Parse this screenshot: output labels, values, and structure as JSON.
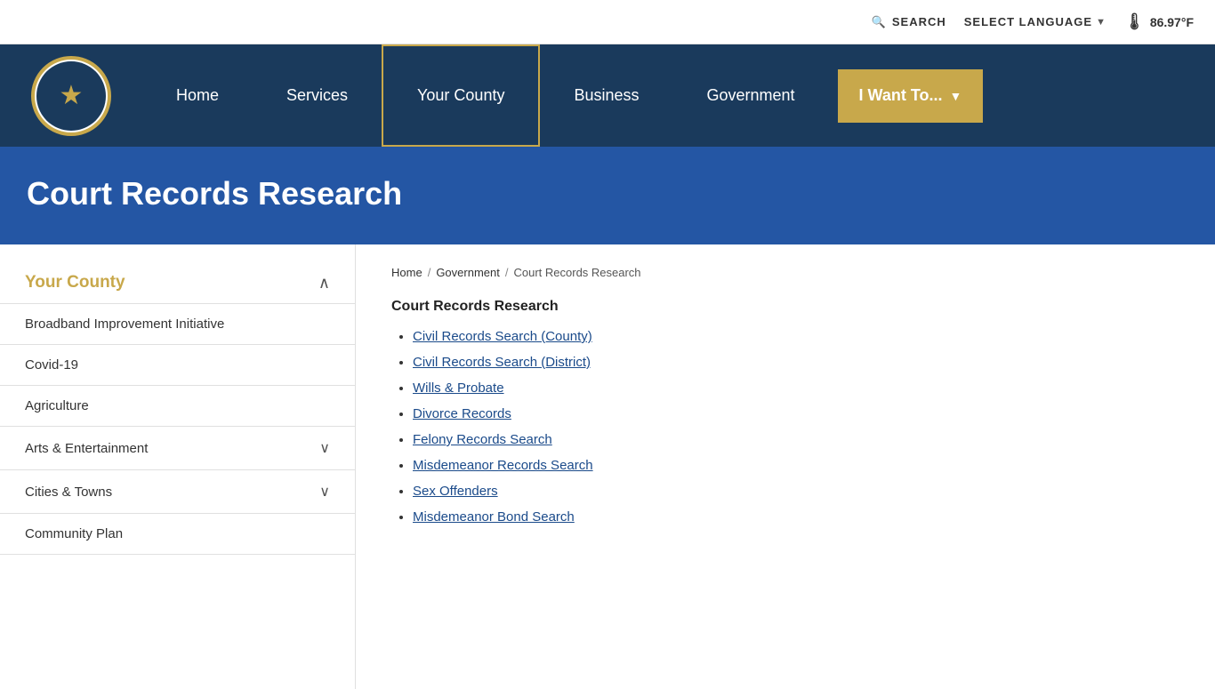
{
  "topbar": {
    "search_label": "SEARCH",
    "language_label": "SELECT LANGUAGE",
    "weather_temp": "86.97°F"
  },
  "header": {
    "logo_alt": "Fort Bend County Seal",
    "nav": {
      "home": "Home",
      "services": "Services",
      "your_county": "Your County",
      "business": "Business",
      "government": "Government",
      "i_want_to": "I Want To..."
    }
  },
  "hero": {
    "title": "Court Records Research"
  },
  "sidebar": {
    "section_title": "Your County",
    "items": [
      {
        "label": "Broadband Improvement Initiative",
        "has_chevron": false
      },
      {
        "label": "Covid-19",
        "has_chevron": false
      },
      {
        "label": "Agriculture",
        "has_chevron": false
      },
      {
        "label": "Arts & Entertainment",
        "has_chevron": true
      },
      {
        "label": "Cities & Towns",
        "has_chevron": true
      },
      {
        "label": "Community Plan",
        "has_chevron": false
      }
    ]
  },
  "breadcrumb": {
    "home": "Home",
    "sep1": "/",
    "government": "Government",
    "sep2": "/",
    "current": "Court Records Research"
  },
  "content": {
    "title": "Court Records Research",
    "links": [
      {
        "label": "Civil Records Search (County)"
      },
      {
        "label": "Civil Records Search (District)"
      },
      {
        "label": "Wills & Probate"
      },
      {
        "label": "Divorce Records"
      },
      {
        "label": "Felony Records Search"
      },
      {
        "label": "Misdemeanor Records Search"
      },
      {
        "label": "Sex Offenders"
      },
      {
        "label": "Misdemeanor Bond Search"
      }
    ]
  }
}
